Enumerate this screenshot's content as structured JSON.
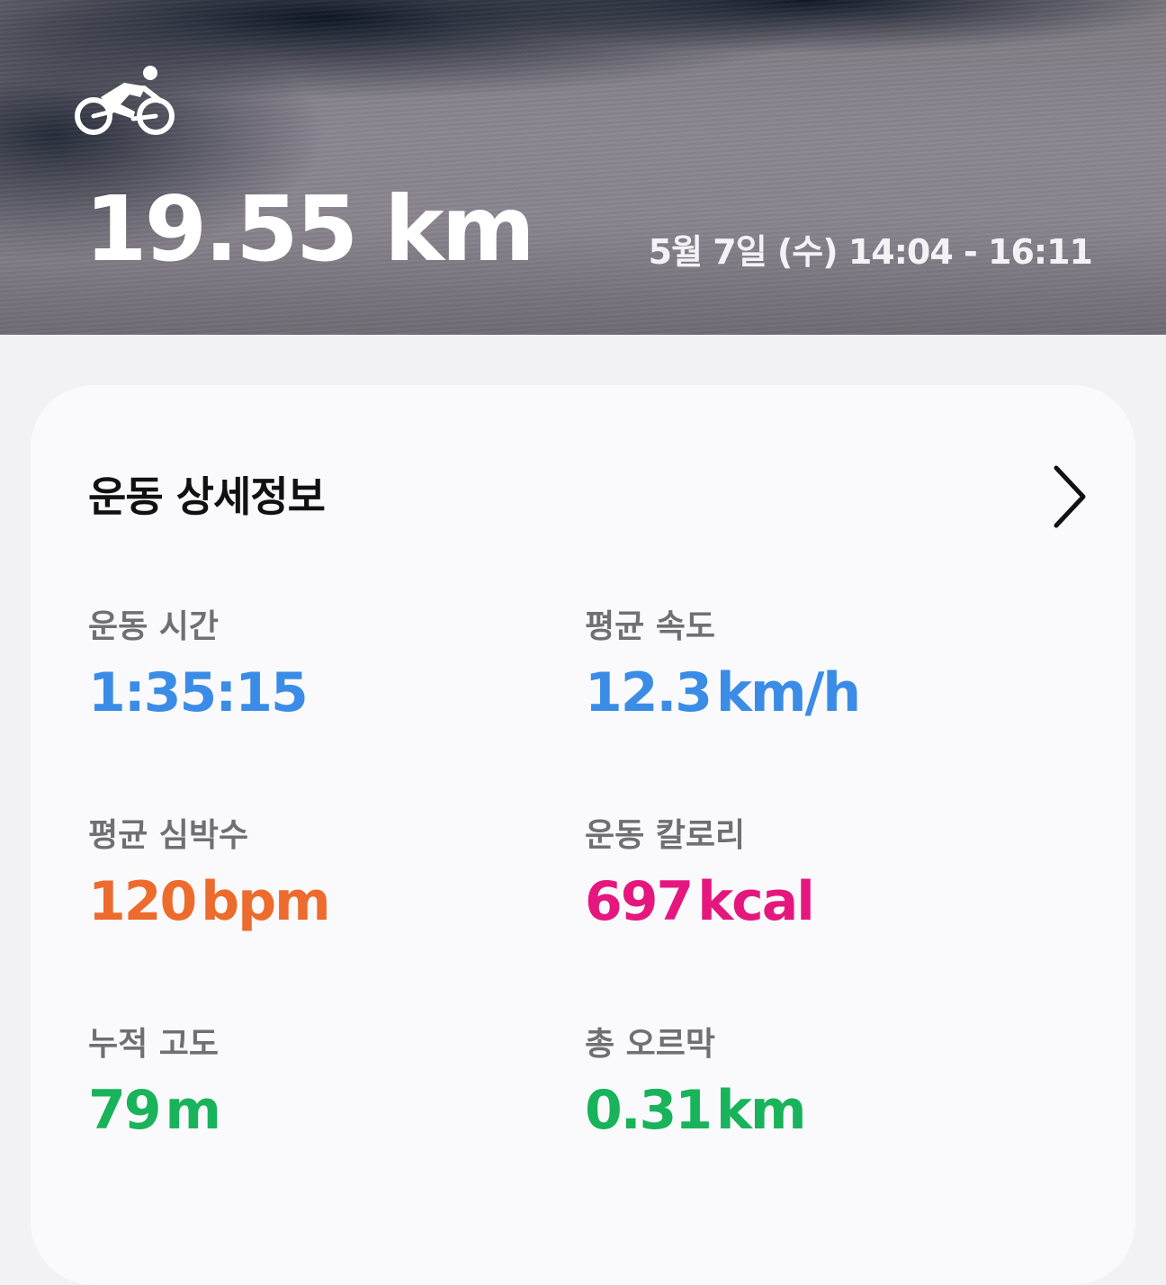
{
  "header": {
    "activity_icon": "bicycle-icon",
    "distance": "19.55 km",
    "datetime": "5월 7일 (수) 14:04 - 16:11"
  },
  "details": {
    "title": "운동 상세정보",
    "chevron_icon": "chevron-right-icon",
    "stats": [
      {
        "label": "운동 시간",
        "value": "1:35:15",
        "unit": "",
        "color": "#3b8ce6"
      },
      {
        "label": "평균 속도",
        "value": "12.3",
        "unit": "km/h",
        "color": "#3b8ce6"
      },
      {
        "label": "평균 심박수",
        "value": "120",
        "unit": "bpm",
        "color": "#ec6b2d"
      },
      {
        "label": "운동 칼로리",
        "value": "697",
        "unit": "kcal",
        "color": "#e5177e"
      },
      {
        "label": "누적 고도",
        "value": "79",
        "unit": "m",
        "color": "#18b35a"
      },
      {
        "label": "총 오르막",
        "value": "0.31",
        "unit": "km",
        "color": "#18b35a"
      }
    ]
  }
}
